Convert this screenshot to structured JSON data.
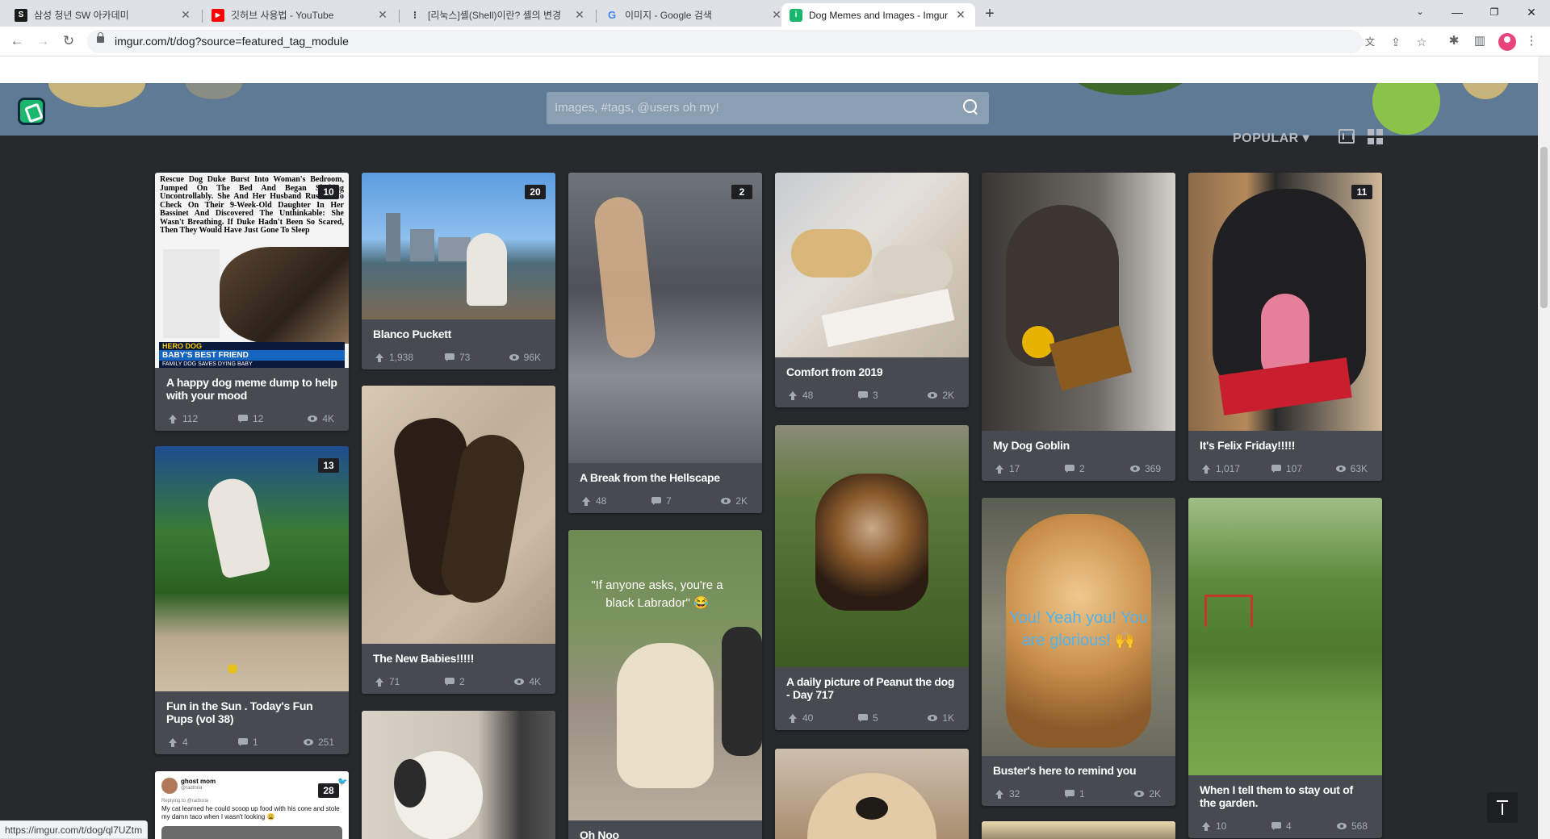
{
  "browser": {
    "tabs": [
      {
        "title": "삼성 청년 SW 아카데미",
        "active": false
      },
      {
        "title": "깃허브 사용법 - YouTube",
        "active": false
      },
      {
        "title": "[리눅스]셸(Shell)이란? 셸의 변경",
        "active": false
      },
      {
        "title": "이미지 - Google 검색",
        "active": false
      },
      {
        "title": "Dog Memes and Images - Imgur",
        "active": true
      }
    ],
    "new_tab": "+",
    "url": "imgur.com/t/dog?source=featured_tag_module",
    "status_url": "https://imgur.com/t/dog/ql7UZtm"
  },
  "header": {
    "search_placeholder": "Images, #tags, @users oh my!",
    "sort_label": "POPULAR ▾"
  },
  "posts": {
    "p1": {
      "title": "A happy dog meme dump to help with your mood",
      "count": "10",
      "up": "112",
      "comments": "12",
      "views": "4K",
      "news_text": "Rescue Dog Duke Burst Into Woman's Bedroom, Jumped On The Bed And Began Shaking Uncontrollably. She And Her Husband Rushed To Check On Their 9-Week-Old Daughter In Her Bassinet And Discovered The Unthinkable: She Wasn't Breathing. If Duke Hadn't Been So Scared, Then They Would Have Just Gone To Sleep",
      "banner1": "HERO DOG",
      "banner2": "BABY'S BEST FRIEND",
      "banner3": "FAMILY DOG SAVES DYING BABY"
    },
    "p2": {
      "title": "Fun in the Sun . Today's Fun Pups (vol 38)",
      "count": "13",
      "up": "4",
      "comments": "1",
      "views": "251"
    },
    "p3": {
      "count": "28",
      "tw_name": "ghost mom",
      "tw_handle": "@radtoria",
      "tw_reply": "Replying to @radtoria",
      "tw_text": "My cat learned he could scoop up food with his cone and stole my damn taco when I wasn't looking 😩"
    },
    "p4": {
      "title": "Blanco Puckett",
      "count": "20",
      "up": "1,938",
      "comments": "73",
      "views": "96K"
    },
    "p5": {
      "title": "The New Babies!!!!!",
      "up": "71",
      "comments": "2",
      "views": "4K"
    },
    "p7": {
      "title": "A Break from the Hellscape",
      "count": "2",
      "up": "48",
      "comments": "7",
      "views": "2K"
    },
    "p8": {
      "title": "Oh Noo",
      "overlay": "\"If anyone asks, you're a black Labrador\" 😂"
    },
    "p9": {
      "title": "Comfort from 2019",
      "up": "48",
      "comments": "3",
      "views": "2K"
    },
    "p10": {
      "title": "A daily picture of Peanut the dog - Day 717",
      "up": "40",
      "comments": "5",
      "views": "1K"
    },
    "p12": {
      "title": "My Dog Goblin",
      "up": "17",
      "comments": "2",
      "views": "369"
    },
    "p13": {
      "title": "Buster's here to remind you",
      "up": "32",
      "comments": "1",
      "views": "2K",
      "overlay": "You! Yeah you! You are glorious! 🙌"
    },
    "p15": {
      "title": "It's Felix Friday!!!!!",
      "count": "11",
      "up": "1,017",
      "comments": "107",
      "views": "63K"
    },
    "p16": {
      "title": "When I tell them to stay out of the garden.",
      "up": "10",
      "comments": "4",
      "views": "568"
    }
  },
  "colors": {
    "header_bg": "#5f7a95",
    "page_bg": "#27292d",
    "card_bg": "#474a51",
    "accent_green": "#1bb76e"
  }
}
